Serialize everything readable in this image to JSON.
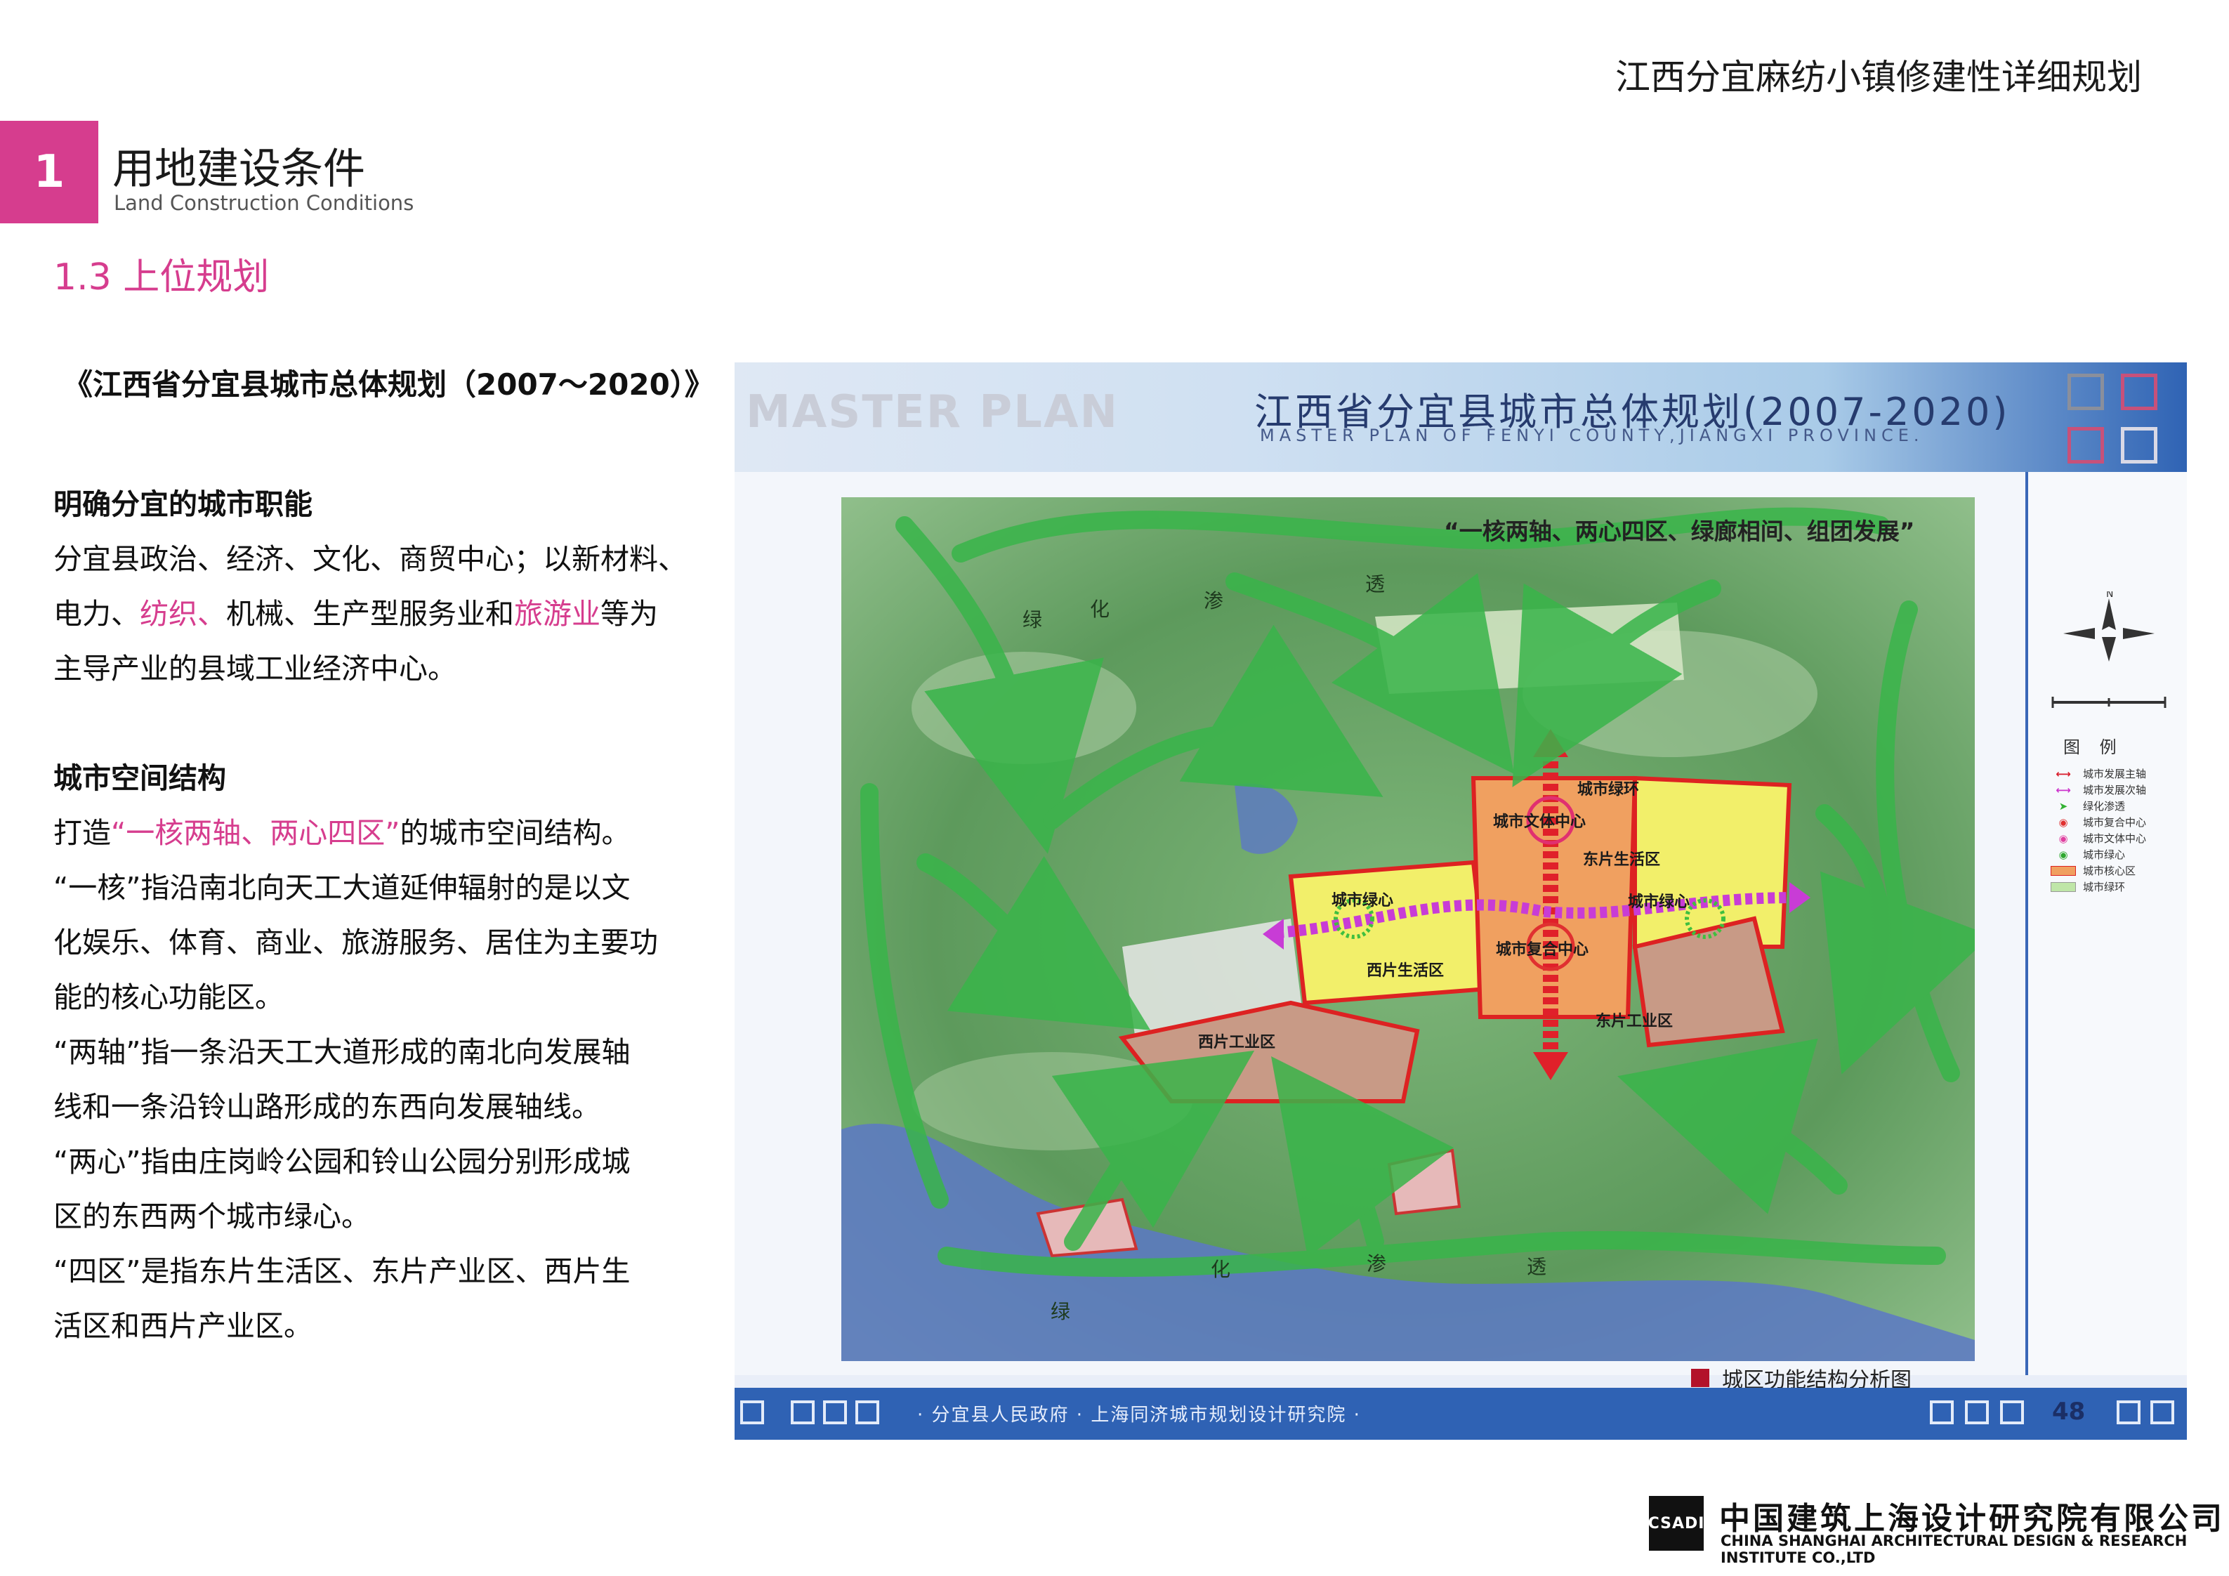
{
  "header": {
    "project_title": "江西分宜麻纺小镇修建性详细规划"
  },
  "section": {
    "number": "1",
    "title": "用地建设条件",
    "subtitle": "Land Construction Conditions",
    "sub_heading": "1.3 上位规划"
  },
  "content": {
    "doc_title": "《江西省分宜县城市总体规划（2007～2020）》",
    "function_heading": "明确分宜的城市职能",
    "function_p1": "分宜县政治、经济、文化、商贸中心；以新材料、",
    "function_p2_a": "电力、",
    "function_p2_b": "纺织、",
    "function_p2_c": "机械、生产型服务业和",
    "function_p2_d": "旅游业",
    "function_p2_e": "等为",
    "function_p3": "主导产业的县域工业经济中心。",
    "structure_heading": "城市空间结构",
    "structure_a": "打造",
    "structure_b": "“一核两轴、两心四区”",
    "structure_c": "的城市空间结构。",
    "lines": [
      "“一核”指沿南北向天工大道延伸辐射的是以文",
      "化娱乐、体育、商业、旅游服务、居住为主要功",
      "能的核心功能区。",
      "“两轴”指一条沿天工大道形成的南北向发展轴",
      "线和一条沿铃山路形成的东西向发展轴线。",
      "“两心”指由庄岗岭公园和铃山公园分别形成城",
      "区的东西两个城市绿心。",
      "“四区”是指东片生活区、东片产业区、西片生",
      "活区和西片产业区。"
    ]
  },
  "map": {
    "watermark": "MASTER PLAN",
    "title_cn": "江西省分宜县城市总体规划(2007-2020)",
    "title_en": "MASTER PLAN OF FENYI COUNTY,JIANGXI PROVINCE.",
    "slogan": "“一核两轴、两心四区、绿廊相间、组团发展”",
    "caption": "城区功能结构分析图",
    "footer_text": "· 分宜县人民政府 · 上海同济城市规划设计研究院 ·",
    "page_number": "48",
    "legend_title": "图 例",
    "legend": [
      {
        "label": "城市发展主轴",
        "color": "#d81b2a"
      },
      {
        "label": "城市发展次轴",
        "color": "#cc33cc"
      },
      {
        "label": "绿化渗透",
        "color": "#33b233"
      },
      {
        "label": "城市复合中心",
        "color": "#e03030"
      },
      {
        "label": "城市文体中心",
        "color": "#e040a0"
      },
      {
        "label": "城市绿心",
        "color": "#2fa82f"
      },
      {
        "label": "城市核心区",
        "color": "#f0a060"
      },
      {
        "label": "城市绿环",
        "color": "#bfe6a8"
      }
    ],
    "labels": {
      "culture_center": "城市文体中心",
      "composite_center": "城市复合中心",
      "green_core_w": "城市绿心",
      "green_core_e": "城市绿心",
      "east_living": "东片生活区",
      "west_living": "西片生活区",
      "east_industry": "东片工业区",
      "west_industry": "西片工业区",
      "green_ring": "城市绿环"
    },
    "greening_chars": [
      "绿",
      "化",
      "渗",
      "透"
    ]
  },
  "company": {
    "logo": "CSADI",
    "name_cn": "中国建筑上海设计研究院有限公司",
    "name_en": "CHINA SHANGHAI ARCHITECTURAL DESIGN & RESEARCH INSTITUTE CO.,LTD"
  }
}
